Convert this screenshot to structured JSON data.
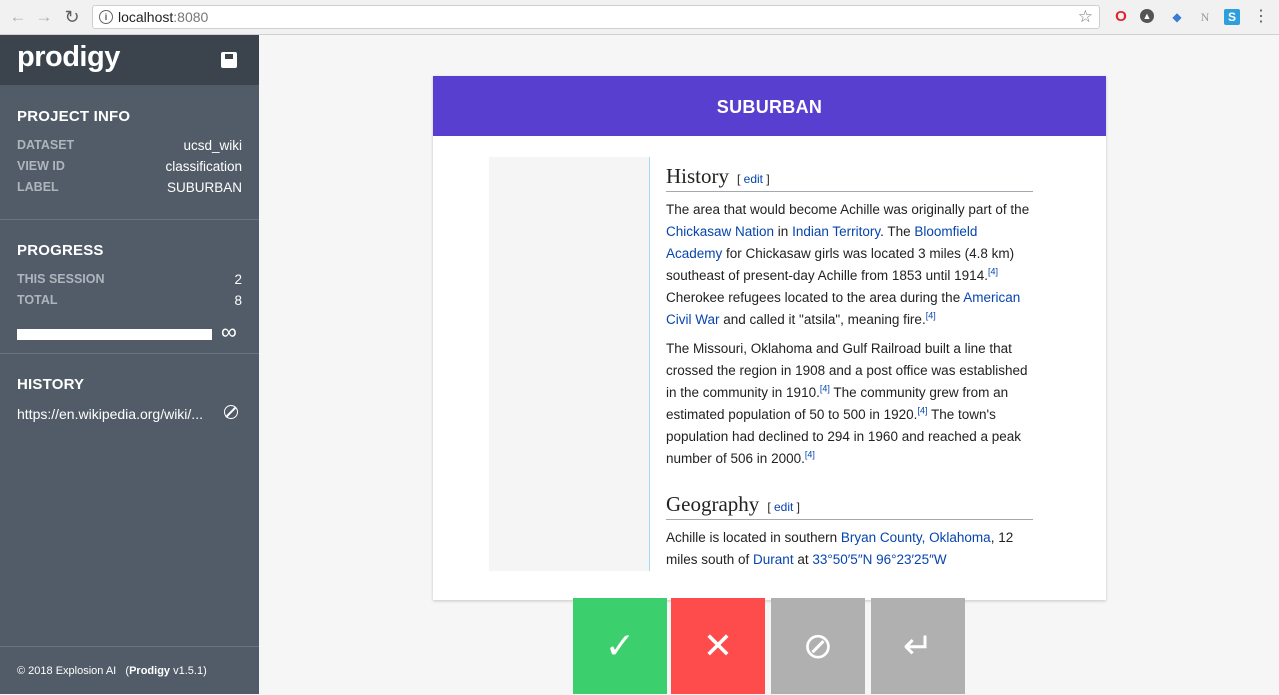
{
  "browser": {
    "url_host": "localhost",
    "url_port": ":8080"
  },
  "sidebar": {
    "logo": "prodigy",
    "project_info": {
      "title": "PROJECT INFO",
      "rows": [
        {
          "key": "DATASET",
          "value": "ucsd_wiki"
        },
        {
          "key": "VIEW ID",
          "value": "classification"
        },
        {
          "key": "LABEL",
          "value": "SUBURBAN"
        }
      ]
    },
    "progress": {
      "title": "PROGRESS",
      "rows": [
        {
          "key": "THIS SESSION",
          "value": "2"
        },
        {
          "key": "TOTAL",
          "value": "8"
        }
      ],
      "bar_fraction": 1.0,
      "end_symbol": "∞"
    },
    "history": {
      "title": "HISTORY",
      "items": [
        {
          "text": "https://en.wikipedia.org/wiki/...",
          "state": "ignored"
        }
      ]
    },
    "footer": {
      "copyright": "© 2018 Explosion AI",
      "product": "Prodigy",
      "version": "v1.5.1"
    }
  },
  "card": {
    "label": "SUBURBAN",
    "sections": {
      "history": {
        "heading": "History",
        "edit_open": "[",
        "edit": "edit",
        "edit_close": "]"
      },
      "geography": {
        "heading": "Geography",
        "edit": "edit"
      }
    },
    "p1": {
      "t1": "The area that would become Achille was originally part of the ",
      "l1": "Chickasaw Nation",
      "t2": " in ",
      "l2": "Indian Territory",
      "t3": ". The ",
      "l3": "Bloomfield Academy",
      "t4": " for Chickasaw girls was located 3 miles (4.8 km) southeast of present-day Achille from 1853 until 1914.",
      "ref": "[4]",
      "t5": " Cherokee refugees located to the area during the ",
      "l4": "American Civil War",
      "t6": " and called it \"atsila\", meaning fire."
    },
    "p2": {
      "t1": "The Missouri, Oklahoma and Gulf Railroad built a line that crossed the region in 1908 and a post office was established in the community in 1910.",
      "t2": " The community grew from an estimated population of 50 to 500 in 1920.",
      "t3": " The town's population had declined to 294 in 1960 and reached a peak number of 506 in 2000."
    },
    "p3": {
      "t1": "Achille is located in southern ",
      "l1": "Bryan County, Oklahoma",
      "t2": ", 12 miles south of ",
      "l2": "Durant",
      "t3": " at ",
      "l3": "33°50′5″N 96°23′25″W"
    }
  },
  "actions": {
    "accept": "✓",
    "reject": "✕",
    "ignore": "⊘",
    "undo": "↵"
  },
  "colors": {
    "header": "#583fcf",
    "accept": "#3ccf6d",
    "reject": "#fe4b4b",
    "neutral": "#b0b0b0",
    "sidebar": "#525c68"
  }
}
